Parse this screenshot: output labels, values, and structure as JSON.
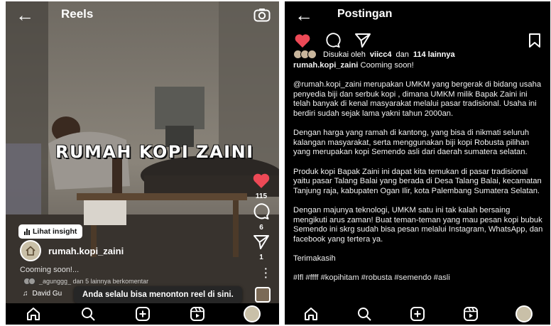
{
  "reels": {
    "title": "Reels",
    "overlay_text": "RUMAH KOPI ZAINI",
    "like_count": "115",
    "comment_count": "6",
    "share_count": "1",
    "insight_button": "Lihat insight",
    "username": "rumah.kopi_zaini",
    "caption": "Cooming soon!...",
    "comment_preview": "_agunggg_ dan 5 lainnya berkomentar",
    "audio_label": "David Gu",
    "toast": "Anda selalu bisa menonton reel di sini."
  },
  "post": {
    "title": "Postingan",
    "liked_by_prefix": "Disukai oleh",
    "liked_by_user": "viicc4",
    "liked_by_connector": "dan",
    "liked_by_others": "114 lainnya",
    "caption_user": "rumah.kopi_zaini",
    "caption_head": "Cooming soon!",
    "paragraphs": [
      "@rumah.kopi_zaini merupakan UMKM yang bergerak di bidang usaha penyedia biji dan serbuk kopi , dimana UMKM milik Bapak Zaini ini telah banyak di kenal masyarakat melalui pasar tradisional. Usaha ini berdiri sudah sejak lama yakni tahun 2000an.",
      "Dengan harga yang ramah di kantong, yang bisa di nikmati seluruh kalangan masyarakat, serta menggunakan biji kopi Robusta pilihan yang merupakan kopi Semendo asli dari daerah sumatera selatan.",
      "Produk kopi Bapak Zaini ini dapat kita temukan di pasar tradisional yaitu pasar Talang Balai yang berada di Desa Talang Balai, kecamatan Tanjung raja, kabupaten Ogan Ilir, kota Palembang Sumatera Selatan.",
      "Dengan majunya teknologi, UMKM satu ini tak kalah bersaing mengikuti arus zaman! Buat teman-teman yang mau pesan kopi bubuk Semendo ini skrg sudah bisa pesan melalui Instagram, WhatsApp, dan facebook yang tertera ya.",
      "Terimakasih"
    ],
    "hashtags": "#lfl #ffff #kopihitam #robusta #semendo #asli"
  },
  "colors": {
    "like_red": "#ed4956",
    "panel_bg": "#000000",
    "toast_bg": "#262626"
  },
  "icons": {
    "nav": [
      "home-icon",
      "search-icon",
      "create-icon",
      "reels-icon",
      "profile-avatar"
    ]
  }
}
